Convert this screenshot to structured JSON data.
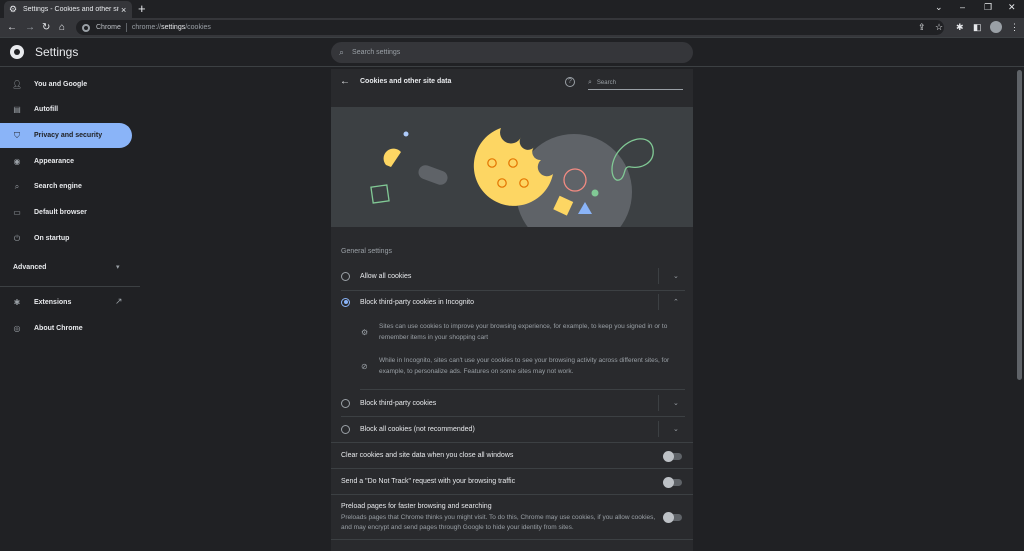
{
  "tab": {
    "title": "Settings - Cookies and other site data"
  },
  "toolbar": {
    "site_label": "Chrome",
    "url_prefix": "chrome://",
    "url_path": "settings",
    "url_suffix": "/cookies"
  },
  "header": {
    "title": "Settings",
    "search_placeholder": "Search settings"
  },
  "sidebar": {
    "items": [
      {
        "label": "You and Google",
        "icon": "person-icon"
      },
      {
        "label": "Autofill",
        "icon": "clipboard-icon"
      },
      {
        "label": "Privacy and security",
        "icon": "shield-icon"
      },
      {
        "label": "Appearance",
        "icon": "palette-icon"
      },
      {
        "label": "Search engine",
        "icon": "search-icon"
      },
      {
        "label": "Default browser",
        "icon": "browser-icon"
      },
      {
        "label": "On startup",
        "icon": "power-icon"
      }
    ],
    "advanced": "Advanced",
    "extensions": "Extensions",
    "about": "About Chrome"
  },
  "panel": {
    "title": "Cookies and other site data",
    "search_placeholder": "Search",
    "section_label": "General settings",
    "options": [
      {
        "label": "Allow all cookies",
        "checked": false
      },
      {
        "label": "Block third-party cookies in Incognito",
        "checked": true
      },
      {
        "label": "Block third-party cookies",
        "checked": false
      },
      {
        "label": "Block all cookies (not recommended)",
        "checked": false
      }
    ],
    "incognito_details": [
      "Sites can use cookies to improve your browsing experience, for example, to keep you signed in or to remember items in your shopping cart",
      "While in Incognito, sites can't use your cookies to see your browsing activity across different sites, for example, to personalize ads. Features on some sites may not work."
    ],
    "toggles": [
      {
        "label": "Clear cookies and site data when you close all windows",
        "on": false
      },
      {
        "label": "Send a \"Do Not Track\" request with your browsing traffic",
        "on": false
      },
      {
        "label": "Preload pages for faster browsing and searching",
        "description": "Preloads pages that Chrome thinks you might visit. To do this, Chrome may use cookies, if you allow cookies, and may encrypt and send pages through Google to hide your identity from sites.",
        "on": false
      }
    ]
  },
  "colors": {
    "accent": "#8ab4f8",
    "background": "#202124",
    "panel": "#292a2d",
    "cookie_yellow": "#fdd663"
  }
}
